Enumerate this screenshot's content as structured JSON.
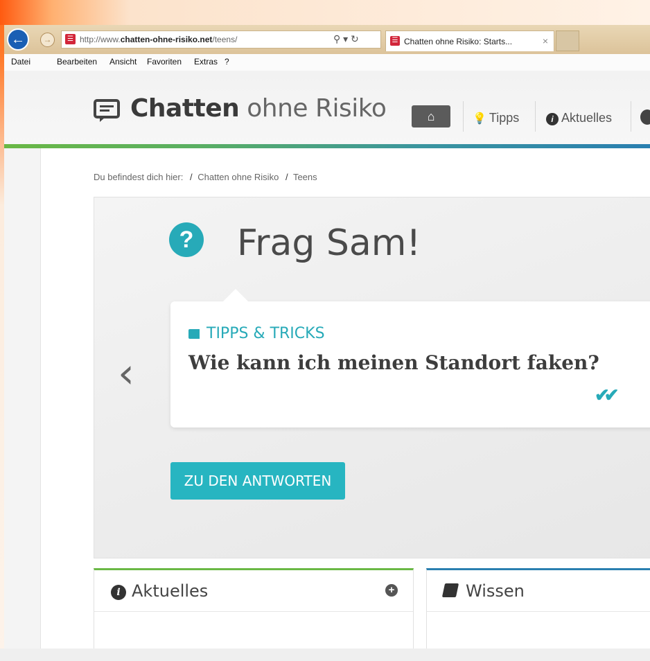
{
  "browser": {
    "url_prefix": "http://www.",
    "url_domain": "chatten-ohne-risiko.net",
    "url_path": "/teens/",
    "address_controls": "⚲ ▾ ↻",
    "tab_title": "Chatten ohne Risiko: Starts...",
    "tab_close": "×",
    "menu": [
      "Datei",
      "Bearbeiten",
      "Ansicht",
      "Favoriten",
      "Extras",
      "?"
    ]
  },
  "site": {
    "logo_bold": "Chatten",
    "logo_light": "ohne Risiko",
    "nav": {
      "home_icon": "⌂",
      "tipps_icon": "💡",
      "tipps": "Tipps",
      "aktuelles_icon": "i",
      "aktuelles": "Aktuelles"
    }
  },
  "breadcrumb": {
    "prefix": "Du befindest dich hier:",
    "sep": "/",
    "item1": "Chatten ohne Risiko",
    "item2": "Teens"
  },
  "hero": {
    "title": "Frag Sam!",
    "question_icon": "?",
    "prev_arrow": "‹",
    "category": "TIPPS & TRICKS",
    "question": "Wie kann ich meinen Standort faken?",
    "check": "✔✔",
    "cta": "ZU DEN ANTWORTEN"
  },
  "panels": {
    "left_title": "Aktuelles",
    "left_plus": "+",
    "right_title": "Wissen"
  },
  "colors": {
    "accent_teal": "#27aab8",
    "green": "#6ab845",
    "blue": "#2a7fb0",
    "ie_blue": "#1a5fb4",
    "favicon_red": "#d2263a"
  }
}
